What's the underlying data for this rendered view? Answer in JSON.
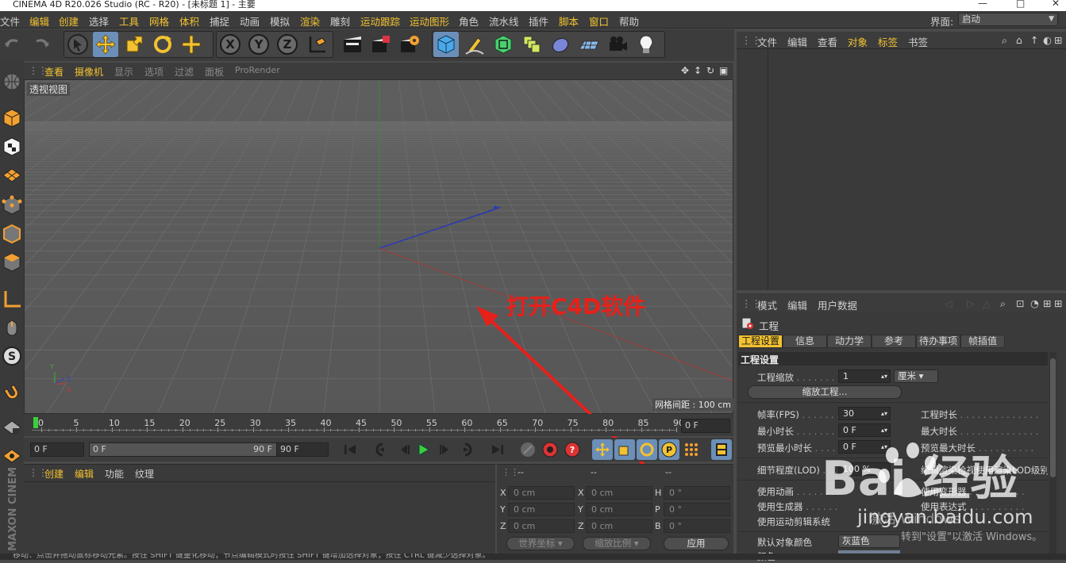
{
  "titlebar": {
    "title": "CINEMA 4D R20.026 Studio (RC - R20) - [未标题 1] - 主要"
  },
  "menubar": {
    "items": [
      "文件",
      "编辑",
      "创建",
      "选择",
      "工具",
      "网格",
      "体积",
      "捕捉",
      "动画",
      "模拟",
      "渲染",
      "雕刻",
      "运动跟踪",
      "运动图形",
      "角色",
      "流水线",
      "插件",
      "脚本",
      "窗口",
      "帮助"
    ],
    "highlighted": [
      1,
      2,
      4,
      5,
      6,
      10,
      12,
      13,
      17,
      18
    ],
    "layout_label": "界面:",
    "layout_value": "启动"
  },
  "toolbar": {
    "icons": [
      "undo-icon",
      "redo-icon",
      "select-arrow-icon",
      "move-icon",
      "scale-icon",
      "rotate-icon",
      "add-object-icon",
      "x-axis-lock-icon",
      "y-axis-lock-icon",
      "z-axis-lock-icon",
      "coordinate-system-icon",
      "render-view-icon",
      "render-picture-viewer-icon",
      "render-settings-icon",
      "cube-icon",
      "pen-icon",
      "subdivision-icon",
      "array-icon",
      "deformer-icon",
      "floor-icon",
      "camera-icon",
      "light-icon"
    ],
    "axis_labels": [
      "X",
      "Y",
      "Z"
    ]
  },
  "left_toolbar": {
    "icons": [
      "viewport-solo-icon",
      "model-mode-icon",
      "texture-mode-icon",
      "workplane-mode-icon",
      "points-mode-icon",
      "edges-mode-icon",
      "polygons-mode-icon",
      "axis-mode-icon",
      "tweak-icon",
      "snap-s-icon",
      "magnet-icon",
      "lock-grid-icon",
      "grid-snap-icon"
    ]
  },
  "viewport": {
    "menu": [
      "查看",
      "摄像机",
      "显示",
      "选项",
      "过滤",
      "面板",
      "ProRender"
    ],
    "menu_highlight": [
      0,
      1
    ],
    "view_label": "透视视图",
    "grid_spacing": "网格间距 : 100 cm",
    "axis_labels": {
      "y": "Y",
      "z": "Z",
      "x": "X"
    }
  },
  "annotation": {
    "text": "打开C4D软件",
    "color": "#e8201a"
  },
  "timeline": {
    "ticks": [
      "0",
      "5",
      "10",
      "15",
      "20",
      "25",
      "30",
      "35",
      "40",
      "45",
      "50",
      "55",
      "60",
      "65",
      "70",
      "75",
      "80",
      "85",
      "90"
    ],
    "end_frame": "0 F"
  },
  "transport": {
    "current_frame": "0 F",
    "range_start": "0 F",
    "range_end": "90 F",
    "max_frame": "90 F",
    "record_letter": "P"
  },
  "material_manager": {
    "menu": [
      "创建",
      "编辑",
      "功能",
      "纹理"
    ],
    "menu_highlight": [
      0,
      1
    ]
  },
  "coordinates": {
    "headers": [
      "--",
      "--",
      "--"
    ],
    "rows": [
      {
        "a": "X",
        "av": "0 cm",
        "b": "X",
        "bv": "0 cm",
        "c": "H",
        "cv": "0 °"
      },
      {
        "a": "Y",
        "av": "0 cm",
        "b": "Y",
        "bv": "0 cm",
        "c": "P",
        "cv": "0 °"
      },
      {
        "a": "Z",
        "av": "0 cm",
        "b": "Z",
        "bv": "0 cm",
        "c": "B",
        "cv": "0 °"
      }
    ],
    "world_coords": "世界坐标",
    "scale_ratio": "缩放比例",
    "apply": "应用"
  },
  "object_manager": {
    "menu": [
      "文件",
      "编辑",
      "查看",
      "对象",
      "标签",
      "书签"
    ],
    "menu_highlight": [
      3,
      4
    ]
  },
  "attribute_manager": {
    "menu": [
      "模式",
      "编辑",
      "用户数据"
    ],
    "project_title": "工程",
    "tabs": [
      "工程设置",
      "信息",
      "动力学",
      "参考",
      "待办事项",
      "帧插值"
    ],
    "active_tab": 0,
    "section_title": "工程设置",
    "project_scale_label": "工程缩放",
    "project_scale_value": "1",
    "project_scale_unit": "厘米",
    "scale_project_button": "缩放工程...",
    "fields": [
      {
        "label": "帧率(FPS)",
        "value": "30",
        "right_label": "工程时长"
      },
      {
        "label": "最小时长",
        "value": "0 F",
        "right_label": "最大时长"
      },
      {
        "label": "预览最小时长",
        "value": "0 F",
        "right_label": "预览最大时长"
      }
    ],
    "lod_label": "细节程度(LOD)",
    "lod_value": "100 %",
    "lod_right": "编辑渲染检视使用渲染LOD级别",
    "use_animation": "使用动画",
    "use_generators": "使用生成器",
    "use_motion_clip": "使用运动剪辑系统",
    "right_col": [
      "使用变形器",
      "使用表达式"
    ],
    "default_color_label": "默认对象颜色",
    "default_color_value": "灰蓝色",
    "color_label": "颜色"
  },
  "watermark": {
    "logo": "Bai 经验",
    "site": "jingyan.baidu.com",
    "activate": "激活 Windows",
    "activate_hint": "转到\"设置\"以激活 Windows。"
  },
  "side_brand": "MAXON CINEMA 4D",
  "statusbar": {
    "text": "移动：点击并拖动鼠标移动元素。按住 SHIFT 键量化移动；节点编辑模式时按住 SHIFT 键增加选择对象；按住 CTRL 键减少选择对象。"
  }
}
